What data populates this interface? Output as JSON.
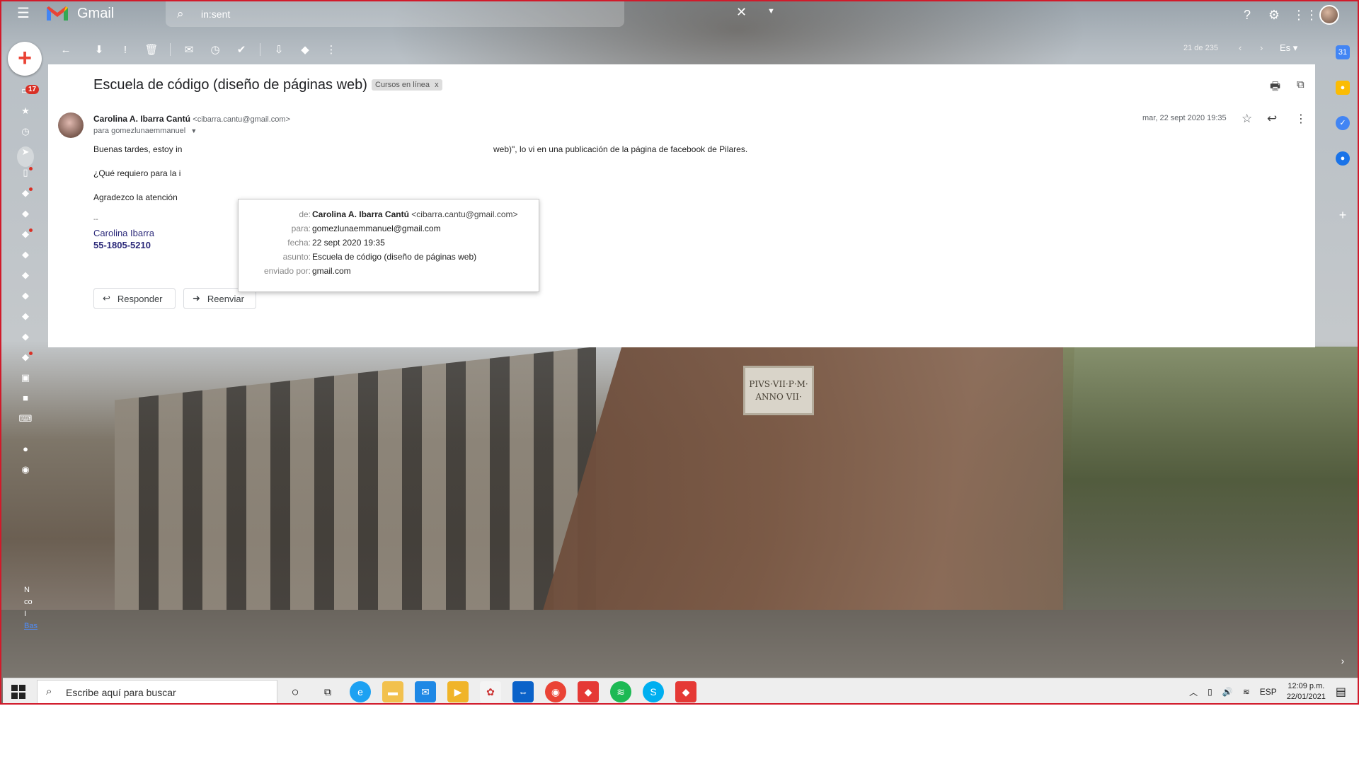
{
  "app": {
    "name": "Gmail"
  },
  "search": {
    "value": "in:sent"
  },
  "nav": {
    "inbox_badge": "17",
    "rail_dots": [
      false,
      false,
      false,
      true,
      true,
      false,
      true,
      false,
      false,
      false,
      false,
      false,
      true,
      false,
      false,
      false
    ]
  },
  "toolbar": {
    "page_count": "21 de 235",
    "lang": "Es"
  },
  "email": {
    "subject": "Escuela de código (diseño de páginas web)",
    "label": "Cursos en línea",
    "label_close": "x",
    "sender_name": "Carolina A. Ibarra Cantú",
    "sender_email": "<cibarra.cantu@gmail.com>",
    "to_line": "para gomezlunaemmanuel",
    "date": "mar, 22 sept 2020 19:35",
    "body_line1_start": "Buenas tardes, estoy in",
    "body_line1_end": "web)\", lo vi en una publicación de la página de facebook de Pilares.",
    "body_line2": "¿Qué requiero para la i",
    "body_line3": "Agradezco la atención",
    "sig_dash": "--",
    "sig_name": "Carolina Ibarra",
    "sig_phone": "55-1805-5210",
    "reply_label": "Responder",
    "forward_label": "Reenviar"
  },
  "details": {
    "from_key": "de:",
    "from_name": "Carolina A. Ibarra Cantú",
    "from_email": "<cibarra.cantu@gmail.com>",
    "to_key": "para:",
    "to_val": "gomezlunaemmanuel@gmail.com",
    "date_key": "fecha:",
    "date_val": "22 sept 2020 19:35",
    "subject_key": "asunto:",
    "subject_val": "Escuela de código (diseño de páginas web)",
    "via_key": "enviado por:",
    "via_val": "gmail.com"
  },
  "background": {
    "plaque_line1": "PIVS·VII·P·M·",
    "plaque_line2": "ANNO VII·"
  },
  "left_fragments": [
    "N",
    "co",
    "I",
    "Bas"
  ],
  "taskbar": {
    "search_placeholder": "Escribe aquí para buscar",
    "lang": "ESP",
    "time": "12:09 p.m.",
    "date": "22/01/2021"
  },
  "colors": {
    "accent": "#d93025",
    "frame": "#d11a2a",
    "signature": "#2c2a7a"
  }
}
